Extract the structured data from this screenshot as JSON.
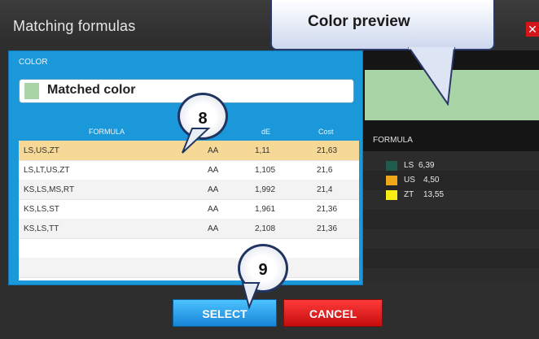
{
  "dialog": {
    "title": "Matching formulas",
    "close_symbol": "✕"
  },
  "color_panel": {
    "label": "COLOR",
    "matched_name": "Matched color",
    "swatch_color": "#a8d4a6"
  },
  "table": {
    "headers": {
      "formula": "FORMULA",
      "de": "dE",
      "cost": "Cost"
    },
    "rows": [
      {
        "formula": "LS,US,ZT",
        "quality": "AA",
        "de": "1,11",
        "cost": "21,63",
        "selected": true
      },
      {
        "formula": "LS,LT,US,ZT",
        "quality": "AA",
        "de": "1,105",
        "cost": "21,6"
      },
      {
        "formula": "KS,LS,MS,RT",
        "quality": "AA",
        "de": "1,992",
        "cost": "21,4"
      },
      {
        "formula": "KS,LS,ST",
        "quality": "AA",
        "de": "1,961",
        "cost": "21,36"
      },
      {
        "formula": "KS,LS,TT",
        "quality": "AA",
        "de": "2,108",
        "cost": "21,36"
      }
    ]
  },
  "preview_panel": {
    "preview_color": "#a8d4a6",
    "formula_header": "FORMULA",
    "items": [
      {
        "name": "LS",
        "value": "6,39",
        "color": "#1f5a4e"
      },
      {
        "name": "US",
        "value": "4,50",
        "color": "#f0a818"
      },
      {
        "name": "ZT",
        "value": "13,55",
        "color": "#f7ee12"
      }
    ]
  },
  "buttons": {
    "select": "SELECT",
    "cancel": "CANCEL"
  },
  "annotations": {
    "callout": "Color preview",
    "badge_8": "8",
    "badge_9": "9"
  }
}
